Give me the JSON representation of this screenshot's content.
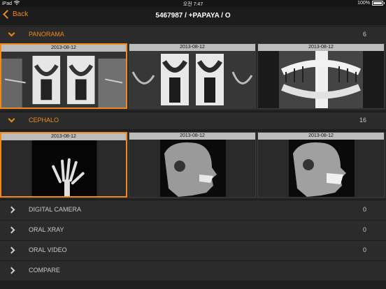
{
  "status": {
    "device": "iPad",
    "time": "오전 7:47",
    "battery": "100%"
  },
  "nav": {
    "back_label": "Back",
    "title": "5467987 / +PAPAYA / O"
  },
  "sections": [
    {
      "title": "PANORAMA",
      "count": "6",
      "expanded": true,
      "thumbs": [
        {
          "date": "2013-08-12"
        },
        {
          "date": "2013-08-12"
        },
        {
          "date": "2013-08-12"
        }
      ]
    },
    {
      "title": "CEPHALO",
      "count": "16",
      "expanded": true,
      "thumbs": [
        {
          "date": "2013-08-12"
        },
        {
          "date": "2013-08-12"
        },
        {
          "date": "2013-08-12"
        }
      ]
    },
    {
      "title": "DIGITAL CAMERA",
      "count": "0",
      "expanded": false
    },
    {
      "title": "ORAL XRAY",
      "count": "0",
      "expanded": false
    },
    {
      "title": "ORAL VIDEO",
      "count": "0",
      "expanded": false
    },
    {
      "title": "COMPARE",
      "count": "",
      "expanded": false
    }
  ],
  "colors": {
    "accent": "#f08a1c",
    "background": "#1f1f1f"
  }
}
